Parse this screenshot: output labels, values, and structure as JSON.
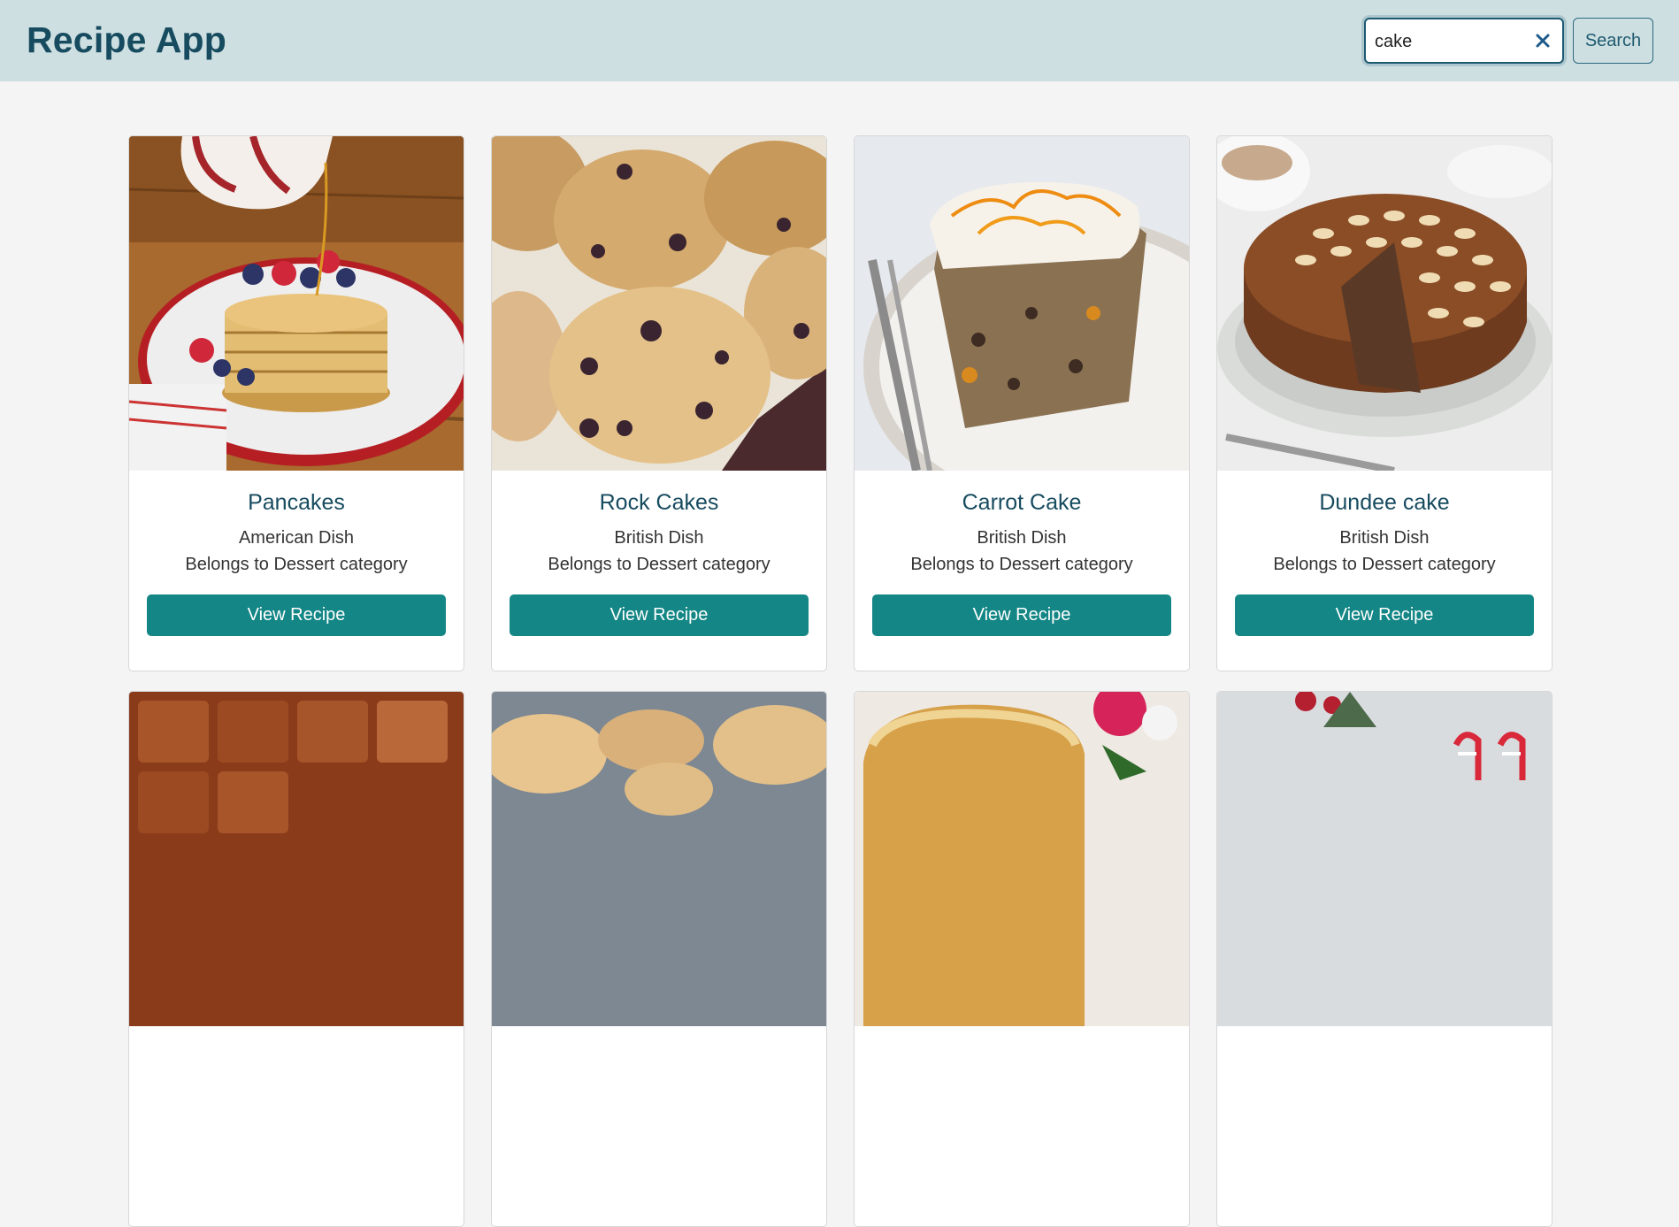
{
  "header": {
    "title": "Recipe App",
    "background": "#cddfe1"
  },
  "search": {
    "value": "cake",
    "placeholder": "",
    "clear_icon": "close-icon",
    "button_label": "Search"
  },
  "cards": [
    {
      "name": "Pancakes",
      "area": "American Dish",
      "category": "Belongs to Dessert category",
      "button_label": "View Recipe"
    },
    {
      "name": "Rock Cakes",
      "area": "British Dish",
      "category": "Belongs to Dessert category",
      "button_label": "View Recipe"
    },
    {
      "name": "Carrot Cake",
      "area": "British Dish",
      "category": "Belongs to Dessert category",
      "button_label": "View Recipe"
    },
    {
      "name": "Dundee cake",
      "area": "British Dish",
      "category": "Belongs to Dessert category",
      "button_label": "View Recipe"
    }
  ],
  "colors": {
    "accent": "#148686",
    "title": "#174b5f",
    "page_background": "#f4f4f4"
  }
}
